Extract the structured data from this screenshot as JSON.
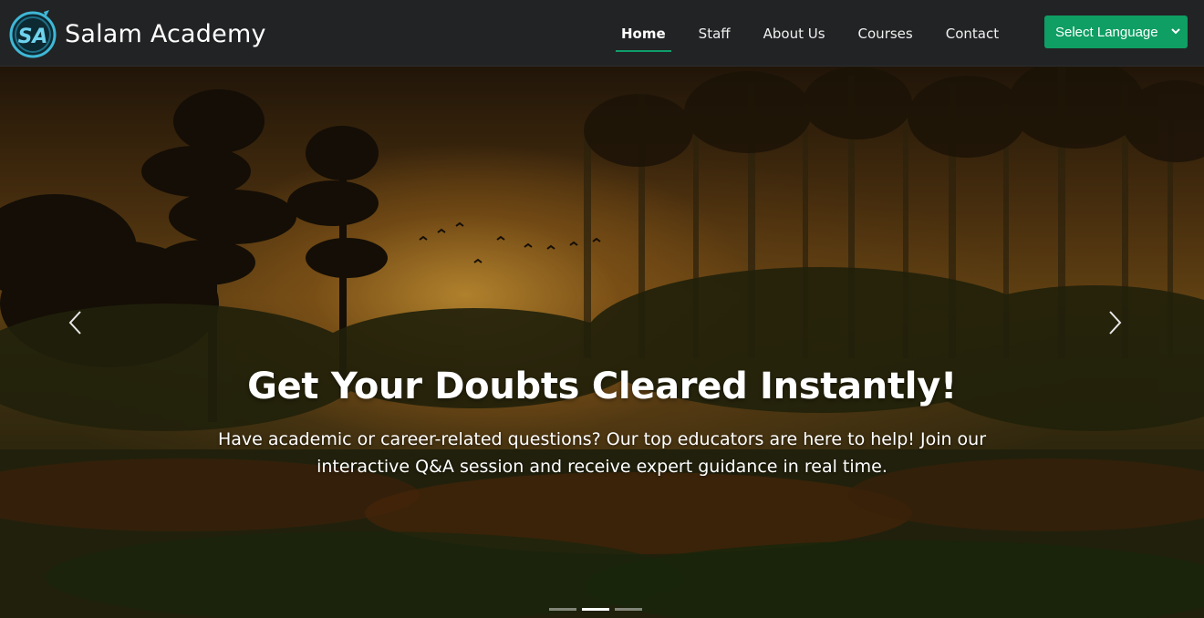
{
  "brand": {
    "name": "Salam Academy",
    "logo_icon": "sa-monogram-logo-icon"
  },
  "nav": {
    "items": [
      {
        "label": "Home",
        "active": true
      },
      {
        "label": "Staff",
        "active": false
      },
      {
        "label": "About Us",
        "active": false
      },
      {
        "label": "Courses",
        "active": false
      },
      {
        "label": "Contact",
        "active": false
      }
    ],
    "language_select": {
      "selected": "Select Language",
      "icon": "chevron-down-icon"
    }
  },
  "hero": {
    "headline": "Get Your Doubts Cleared Instantly!",
    "subtext": "Have academic or career-related questions? Our top educators are here to help! Join our interactive Q&A session and receive expert guidance in real time.",
    "prev_icon": "chevron-left-icon",
    "next_icon": "chevron-right-icon",
    "slides": {
      "count": 3,
      "active_index": 1
    }
  },
  "colors": {
    "navbar_bg": "#222324",
    "accent_green": "#0f9e63",
    "active_underline": "#0f9d6b",
    "text": "#ffffff"
  }
}
